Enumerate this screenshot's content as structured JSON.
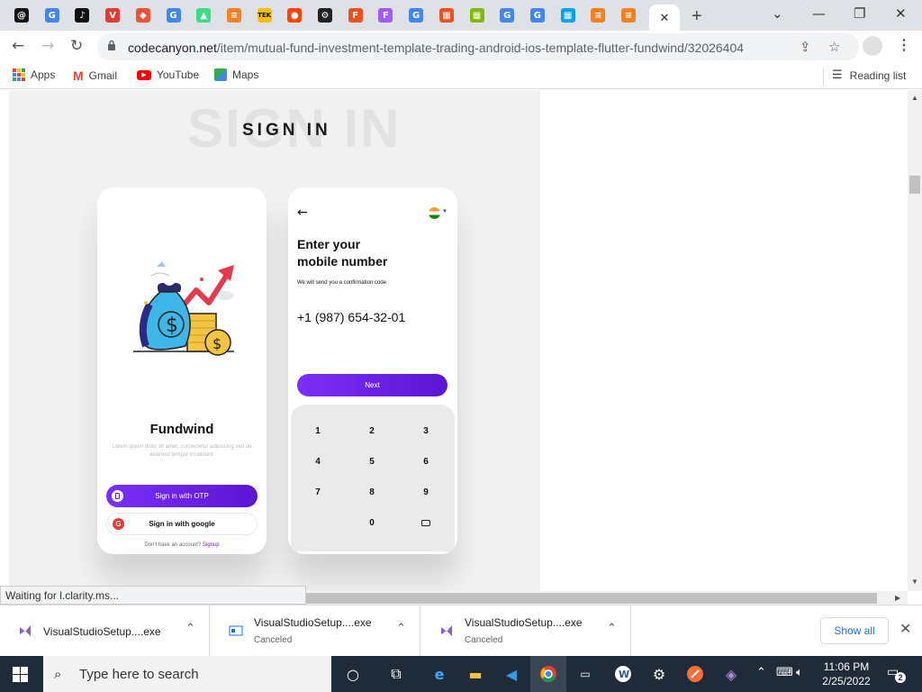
{
  "browser": {
    "tabs": [
      {
        "icon": "threads-icon",
        "glyph": "@",
        "color": "#111111"
      },
      {
        "icon": "google-icon",
        "glyph": "G",
        "color": "#4285f4"
      },
      {
        "icon": "tiktok-icon",
        "glyph": "♪",
        "color": "#111111"
      },
      {
        "icon": "v-icon",
        "glyph": "V",
        "color": "#e53935"
      },
      {
        "icon": "swift-icon",
        "glyph": "◆",
        "color": "#f05138"
      },
      {
        "icon": "google-icon",
        "glyph": "G",
        "color": "#4285f4"
      },
      {
        "icon": "android-icon",
        "glyph": "▲",
        "color": "#3ddc84"
      },
      {
        "icon": "stackoverflow-icon",
        "glyph": "≡",
        "color": "#f48024"
      },
      {
        "icon": "tek-icon",
        "glyph": "TEK",
        "color": "#f6c000"
      },
      {
        "icon": "reddit-icon",
        "glyph": "●",
        "color": "#ff4500"
      },
      {
        "icon": "gear-icon",
        "glyph": "⚙",
        "color": "#222222"
      },
      {
        "icon": "figma-icon",
        "glyph": "F",
        "color": "#f24e1e"
      },
      {
        "icon": "figma-icon",
        "glyph": "F",
        "color": "#a259ff"
      },
      {
        "icon": "google-icon",
        "glyph": "G",
        "color": "#4285f4"
      },
      {
        "icon": "microsoft-icon",
        "glyph": "▦",
        "color": "#f25022"
      },
      {
        "icon": "microsoft-icon",
        "glyph": "▦",
        "color": "#7fba00"
      },
      {
        "icon": "google-icon",
        "glyph": "G",
        "color": "#4285f4"
      },
      {
        "icon": "google-icon",
        "glyph": "G",
        "color": "#4285f4"
      },
      {
        "icon": "microsoft-icon",
        "glyph": "▦",
        "color": "#00a4ef"
      },
      {
        "icon": "stackoverflow-icon",
        "glyph": "≡",
        "color": "#f48024"
      },
      {
        "icon": "stackoverflow-icon",
        "glyph": "≡",
        "color": "#f48024"
      }
    ],
    "active_tab_close": "✕",
    "new_tab": "+",
    "window_controls": {
      "tab_search": "⌄",
      "minimize": "—",
      "restore": "❐",
      "close": "✕"
    },
    "url_host": "codecanyon.net",
    "url_path": "/item/mutual-fund-investment-template-trading-android-ios-template-flutter-fundwind/32026404",
    "bookmarks": [
      {
        "label": "Apps",
        "icon": "apps-grid-icon"
      },
      {
        "label": "Gmail",
        "icon": "gmail-icon"
      },
      {
        "label": "YouTube",
        "icon": "youtube-icon"
      },
      {
        "label": "Maps",
        "icon": "maps-icon"
      }
    ],
    "reading_list": "Reading list",
    "status_text": "Waiting for l.clarity.ms..."
  },
  "page": {
    "title_bg": "SIGN IN",
    "title": "SIGN IN",
    "phone1": {
      "app_name": "Fundwind",
      "description": "Lorem ipsum dolor sit amet, consectetur adipiscing sed do eiusmod tempor incididunt.",
      "otp_button": "Sign in with OTP",
      "google_button": "Sign in with google",
      "google_letter": "G",
      "signup_prompt": "Don't have an account?",
      "signup_link": "Signup"
    },
    "phone2": {
      "back": "←",
      "heading_line1": "Enter your",
      "heading_line2": "mobile number",
      "subtext": "We will send you a confirmation code",
      "phone_number": "+1 (987) 654-32-01",
      "next_button": "Next",
      "keys": [
        "1",
        "2",
        "3",
        "4",
        "5",
        "6",
        "7",
        "8",
        "9",
        "0"
      ]
    }
  },
  "downloads": {
    "items": [
      {
        "name": "VisualStudioSetup....exe",
        "status": ""
      },
      {
        "name": "VisualStudioSetup....exe",
        "status": "Canceled"
      },
      {
        "name": "VisualStudioSetup....exe",
        "status": "Canceled"
      }
    ],
    "show_all": "Show all"
  },
  "taskbar": {
    "search_placeholder": "Type here to search",
    "time": "11:06 PM",
    "date": "2/25/2022",
    "notification_count": "2"
  },
  "colors": {
    "accent_purple": "#6a1fe6",
    "page_bg": "#f1f1f1",
    "taskbar_bg": "#1f2b38"
  }
}
